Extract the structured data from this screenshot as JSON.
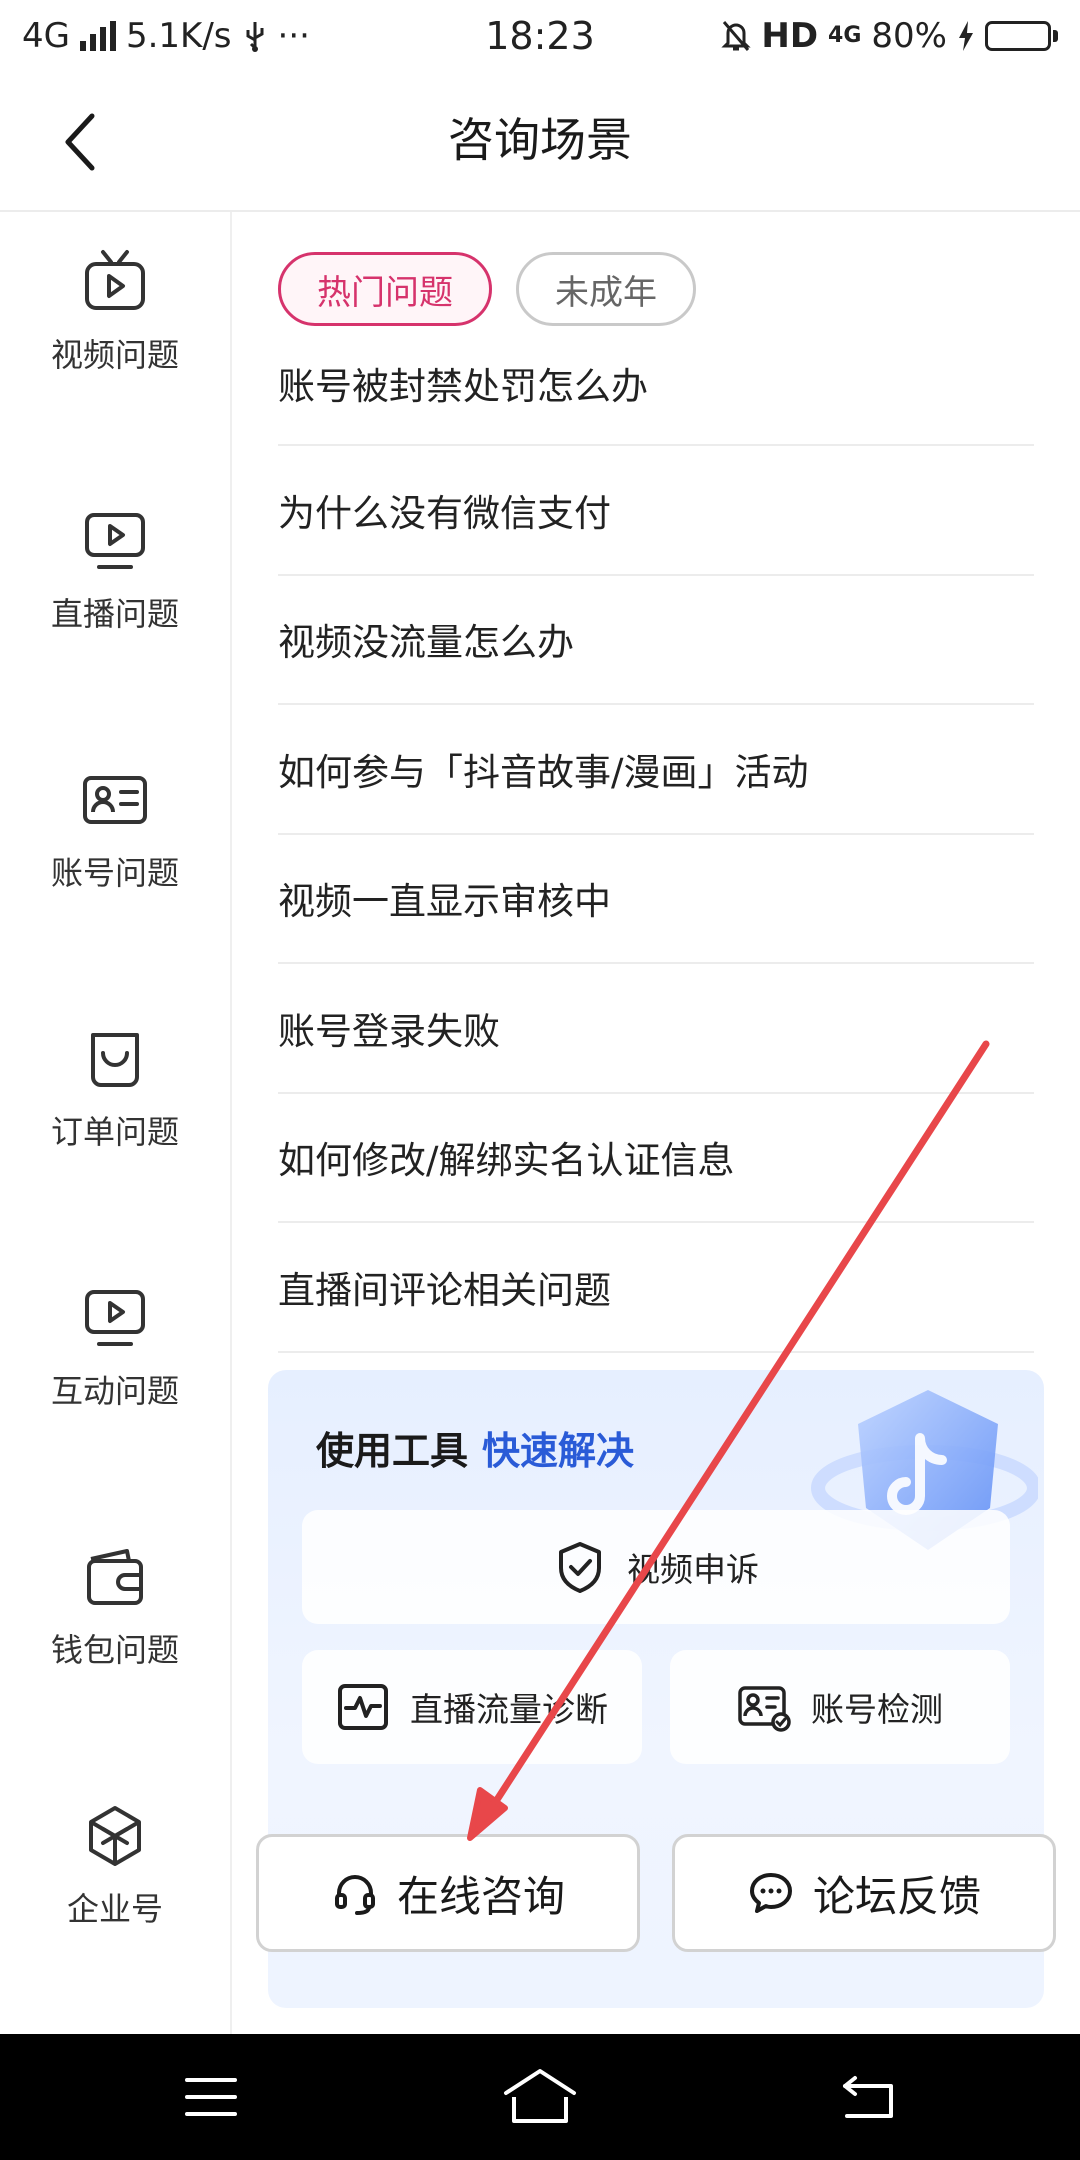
{
  "status_bar": {
    "network": "4G",
    "speed": "5.1K/s",
    "usb_icon": "usb-icon",
    "more": "···",
    "time": "18:23",
    "hd": "HD",
    "network_right": "4G",
    "battery_percent": "80%",
    "battery_level": 0.8
  },
  "header": {
    "title": "咨询场景",
    "back_icon": "chevron-left-icon"
  },
  "sidebar": {
    "items": [
      {
        "label": "视频问题",
        "icon": "tv-play-icon"
      },
      {
        "label": "直播问题",
        "icon": "monitor-play-icon"
      },
      {
        "label": "账号问题",
        "icon": "id-card-icon"
      },
      {
        "label": "订单问题",
        "icon": "shopping-bag-icon"
      },
      {
        "label": "互动问题",
        "icon": "monitor-play-icon"
      },
      {
        "label": "钱包问题",
        "icon": "wallet-icon"
      },
      {
        "label": "企业号",
        "icon": "cube-icon"
      }
    ]
  },
  "tabs": [
    {
      "label": "热门问题",
      "active": true
    },
    {
      "label": "未成年",
      "active": false
    }
  ],
  "questions": [
    "账号被封禁处罚怎么办",
    "为什么没有微信支付",
    "视频没流量怎么办",
    "如何参与「抖音故事/漫画」活动",
    "视频一直显示审核中",
    "账号登录失败",
    "如何修改/解绑实名认证信息",
    "直播间评论相关问题"
  ],
  "tools": {
    "title_part1": "使用工具",
    "title_part2": "快速解决",
    "video_appeal": "视频申诉",
    "live_diagnosis": "直播流量诊断",
    "account_check": "账号检测"
  },
  "actions": {
    "online_consult": "在线咨询",
    "forum_feedback": "论坛反馈"
  },
  "colors": {
    "accent_pink": "#d6336c",
    "accent_blue": "#2a5bd7",
    "annotation_arrow": "#e8474a"
  }
}
